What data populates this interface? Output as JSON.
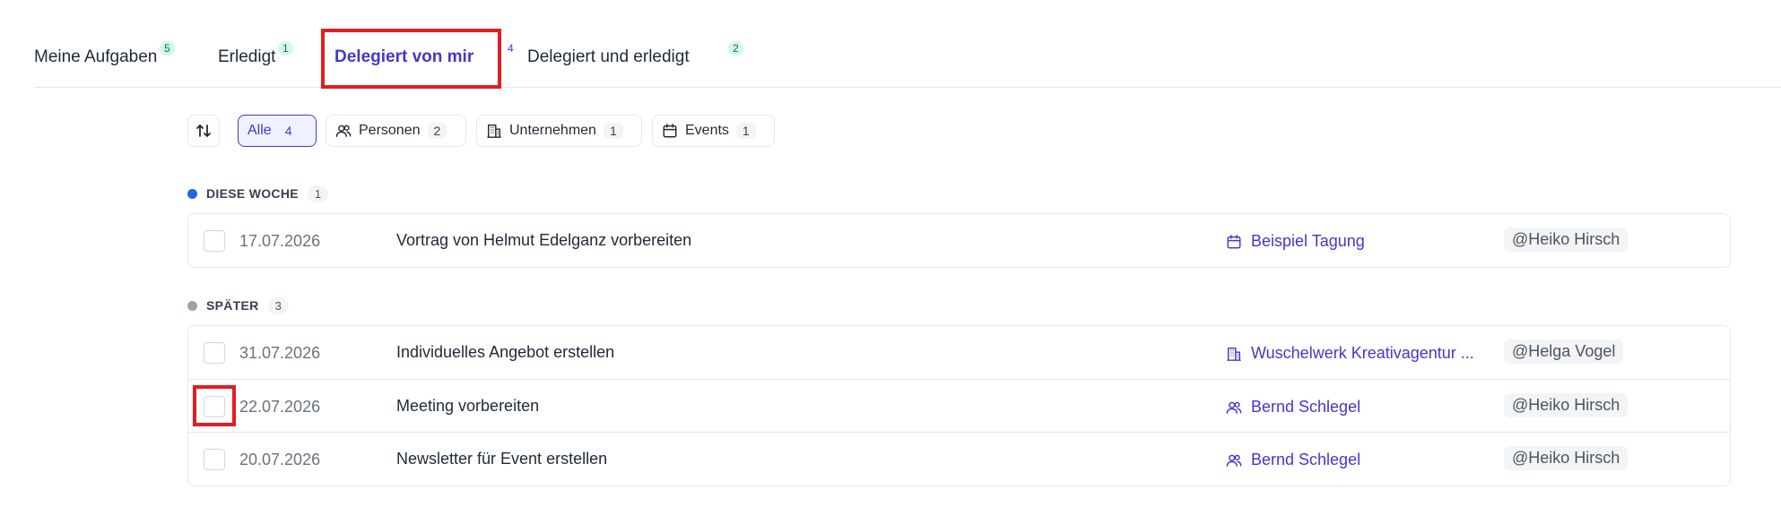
{
  "tabs": [
    {
      "label": "Meine Aufgaben",
      "count": "5"
    },
    {
      "label": "Erledigt",
      "count": "1"
    },
    {
      "label": "Delegiert von mir",
      "count": "4"
    },
    {
      "label": "Delegiert und erledigt",
      "count": "2"
    }
  ],
  "active_tab": "Delegiert von mir",
  "filters": [
    {
      "label": "Alle",
      "count": "4",
      "icon": "none"
    },
    {
      "label": "Personen",
      "count": "2",
      "icon": "users-icon"
    },
    {
      "label": "Unternehmen",
      "count": "1",
      "icon": "building-icon"
    },
    {
      "label": "Events",
      "count": "1",
      "icon": "calendar-icon"
    }
  ],
  "sections": [
    {
      "title": "DIESE WOCHE",
      "count": "1",
      "dot_color": "#2563eb",
      "tasks": [
        {
          "date": "17.07.2026",
          "title": "Vortrag von Helmut Edelganz vorbereiten",
          "link": "Beispiel Tagung",
          "link_icon": "calendar-icon",
          "assignee": "@Heiko Hirsch"
        }
      ]
    },
    {
      "title": "SPÄTER",
      "count": "3",
      "dot_color": "#9ca3af",
      "tasks": [
        {
          "date": "31.07.2026",
          "title": "Individuelles Angebot erstellen",
          "link": "Wuschelwerk Kreativagentur ...",
          "link_icon": "building-icon",
          "assignee": "@Helga Vogel"
        },
        {
          "date": "22.07.2026",
          "title": "Meeting vorbereiten",
          "link": "Bernd Schlegel",
          "link_icon": "users-icon",
          "assignee": "@Heiko Hirsch"
        },
        {
          "date": "20.07.2026",
          "title": "Newsletter für Event erstellen",
          "link": "Bernd Schlegel",
          "link_icon": "users-icon",
          "assignee": "@Heiko Hirsch"
        }
      ]
    }
  ]
}
